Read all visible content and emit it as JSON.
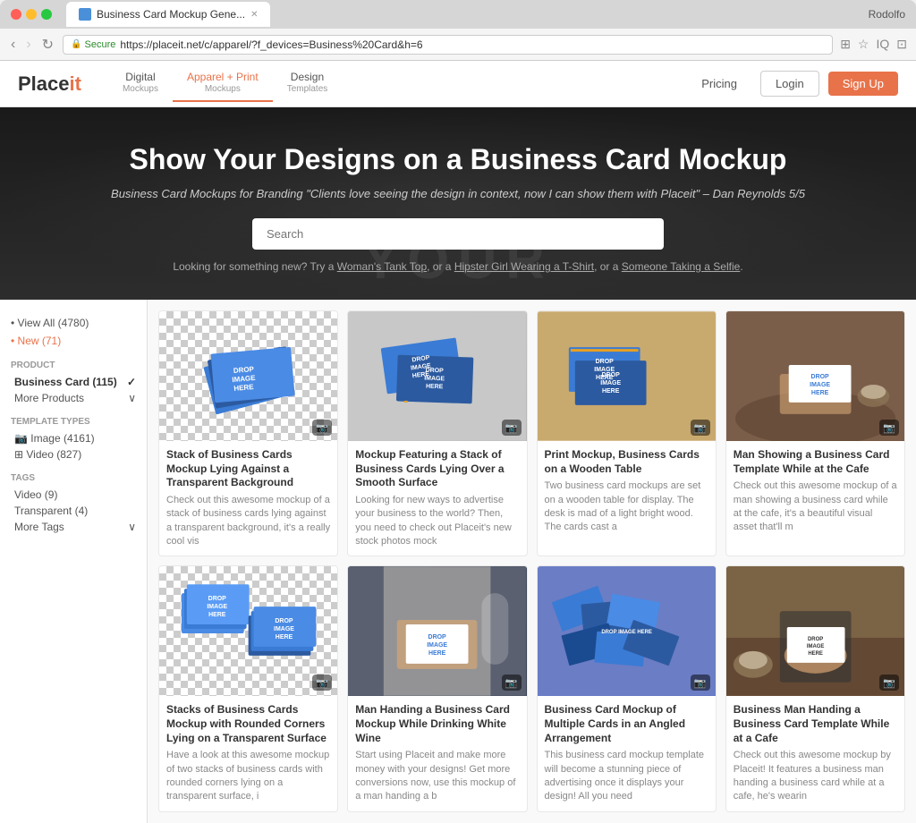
{
  "browser": {
    "tab_title": "Business Card Mockup Gene...",
    "url": "https://placeit.net/c/apparel/?f_devices=Business%20Card&h=6",
    "user": "Rodolfo"
  },
  "nav": {
    "logo": "Placeit",
    "items": [
      {
        "label": "Digital",
        "sub": "Mockups",
        "active": false
      },
      {
        "label": "Apparel + Print",
        "sub": "Mockups",
        "active": true
      },
      {
        "label": "Design",
        "sub": "Templates",
        "active": false
      }
    ],
    "pricing": "Pricing",
    "login": "Login",
    "signup": "Sign Up"
  },
  "hero": {
    "title": "Show Your Designs on a Business Card Mockup",
    "subtitle": "Business Card Mockups for Branding \"Clients love seeing the design in context, now I can show them with Placeit\" – Dan Reynolds 5/5",
    "search_placeholder": "Search",
    "links_prefix": "Looking for something new? Try a",
    "link1": "Woman's Tank Top",
    "link2": "Hipster Girl Wearing a T-Shirt",
    "link3": "Someone Taking a Selfie",
    "watermark": "YOUR"
  },
  "sidebar": {
    "view_all": "• View All (4780)",
    "new": "• New (71)",
    "product_section": "Product",
    "business_card": "Business Card (115)",
    "more_products": "More Products",
    "template_types": "Template Types",
    "image": "Image (4161)",
    "video": "Video (827)",
    "tags": "Tags",
    "tag_video": "Video (9)",
    "tag_transparent": "Transparent (4)",
    "more_tags": "More Tags"
  },
  "cards": [
    {
      "title": "Stack of Business Cards Mockup Lying Against a Transparent Background",
      "desc": "Check out this awesome mockup of a stack of business cards lying against a transparent background, it's a really cool vis",
      "type": "checker"
    },
    {
      "title": "Mockup Featuring a Stack of Business Cards Lying Over a Smooth Surface",
      "desc": "Looking for new ways to advertise your business to the world? Then, you need to check out Placeit's new stock photos mock",
      "type": "blue"
    },
    {
      "title": "Print Mockup, Business Cards on a Wooden Table",
      "desc": "Two business card mockups are set on a wooden table for display. The desk is mad of a light bright wood. The cards cast a",
      "type": "wood"
    },
    {
      "title": "Man Showing a Business Card Template While at the Cafe",
      "desc": "Check out this awesome mockup of a man showing a business card while at the cafe, it's a beautiful visual asset that'll m",
      "type": "cafe"
    },
    {
      "title": "Stacks of Business Cards Mockup with Rounded Corners Lying on a Transparent Surface",
      "desc": "Have a look at this awesome mockup of two stacks of business cards with rounded corners lying on a transparent surface, i",
      "type": "checker2"
    },
    {
      "title": "Man Handing a Business Card Mockup While Drinking White Wine",
      "desc": "Start using Placeit and make more money with your designs! Get more conversions now, use this mockup of a man handing a b",
      "type": "wine"
    },
    {
      "title": "Business Card Mockup of Multiple Cards in an Angled Arrangement",
      "desc": "This business card mockup template will become a stunning piece of advertising once it displays your design! All you need",
      "type": "angle"
    },
    {
      "title": "Business Man Handing a Business Card Template While at a Cafe",
      "desc": "Check out this awesome mockup by Placeit! It features a business man handing a business card while at a cafe, he's wearin",
      "type": "cafe2"
    }
  ]
}
